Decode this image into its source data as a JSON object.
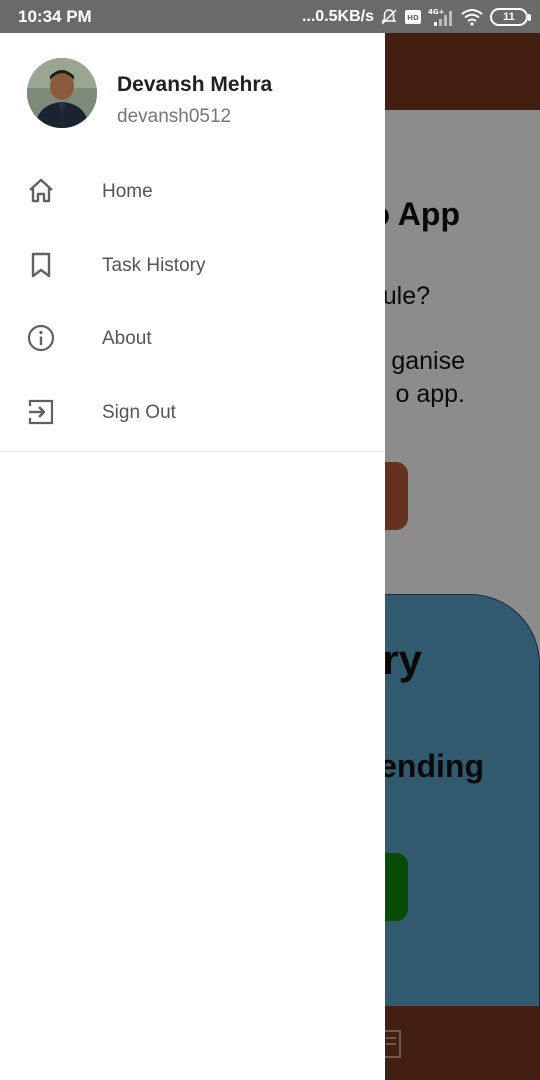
{
  "status_bar": {
    "time": "10:34 PM",
    "net_speed": "...0.5KB/s",
    "battery_level": "11",
    "icons": [
      "mute-bell-icon",
      "volte-icon",
      "4g-signal-icon",
      "wifi-icon",
      "battery-icon"
    ]
  },
  "drawer": {
    "user": {
      "name": "Devansh Mehra",
      "handle": "devansh0512"
    },
    "items": [
      {
        "label": "Home",
        "icon": "home-icon"
      },
      {
        "label": "Task History",
        "icon": "bookmark-icon"
      },
      {
        "label": "About",
        "icon": "info-icon"
      },
      {
        "label": "Sign Out",
        "icon": "sign-out-icon"
      }
    ]
  },
  "background_app": {
    "title": "o App",
    "question": "ule?",
    "description_line1": "ganise",
    "description_line2": "o app.",
    "card_title": "ry",
    "card_subtitle": "ending"
  },
  "colors": {
    "status_bar": "#6a6a6a",
    "app_bar_brown": "#7a3a22",
    "card_blue": "#5aa4c9",
    "button_green": "#0b8a0b",
    "button_brown": "#b65b34",
    "drawer_bg": "#ffffff",
    "menu_text": "#555555"
  }
}
